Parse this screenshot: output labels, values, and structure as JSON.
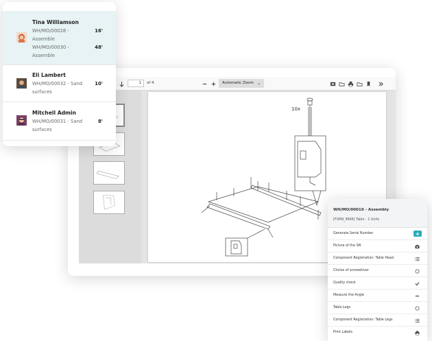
{
  "colors": {
    "accent": "#2ea8b4",
    "active_row": "#e7f3f5"
  },
  "viewer": {
    "page_number": "1",
    "page_of": "of 4",
    "zoom": "Automatic Zoom",
    "diagram_label": "10x",
    "icons": [
      "sidebar-toggle-icon",
      "arrow-up-icon",
      "arrow-down-icon",
      "zoom-out-icon",
      "zoom-in-icon",
      "presentation-icon",
      "open-file-icon",
      "print-icon",
      "download-icon",
      "bookmark-icon",
      "tools-icon"
    ]
  },
  "orders": [
    {
      "name": "Tina Williamson",
      "refs": [
        "WH/MO/00028 - Assemble",
        "WH/MO/00030 - Assemble"
      ],
      "durations": [
        "16'",
        "48'"
      ],
      "avatar": "avatar-tina"
    },
    {
      "name": "Eli Lambert",
      "refs": [
        "WH/MO/00032 - Sand surfaces"
      ],
      "durations": [
        "10'"
      ],
      "avatar": "avatar-eli"
    },
    {
      "name": "Mitchell Admin",
      "refs": [
        "WH/MO/00031 - Sand surfaces"
      ],
      "durations": [
        "8'"
      ],
      "avatar": "avatar-mitchell"
    }
  ],
  "checklist": {
    "title": "WH/MO/00010 - Assembly",
    "subtitle": "[FURN_9666] Table - 1 Units",
    "steps": [
      {
        "label": "Generate Serial Number",
        "icon": "plus-icon"
      },
      {
        "label": "Picture of the SN",
        "icon": "camera-icon"
      },
      {
        "label": "Component Registration: Table Head",
        "icon": "list-icon"
      },
      {
        "label": "Choice of screwdriver",
        "icon": "circle-icon"
      },
      {
        "label": "Quality check",
        "icon": "check-icon"
      },
      {
        "label": "Measure the Angle",
        "icon": "minus-icon"
      },
      {
        "label": "Table Legs",
        "icon": "circle-icon"
      },
      {
        "label": "Component Registration: Table Legs",
        "icon": "list-icon"
      },
      {
        "label": "Print Labels",
        "icon": "print-icon"
      }
    ]
  }
}
